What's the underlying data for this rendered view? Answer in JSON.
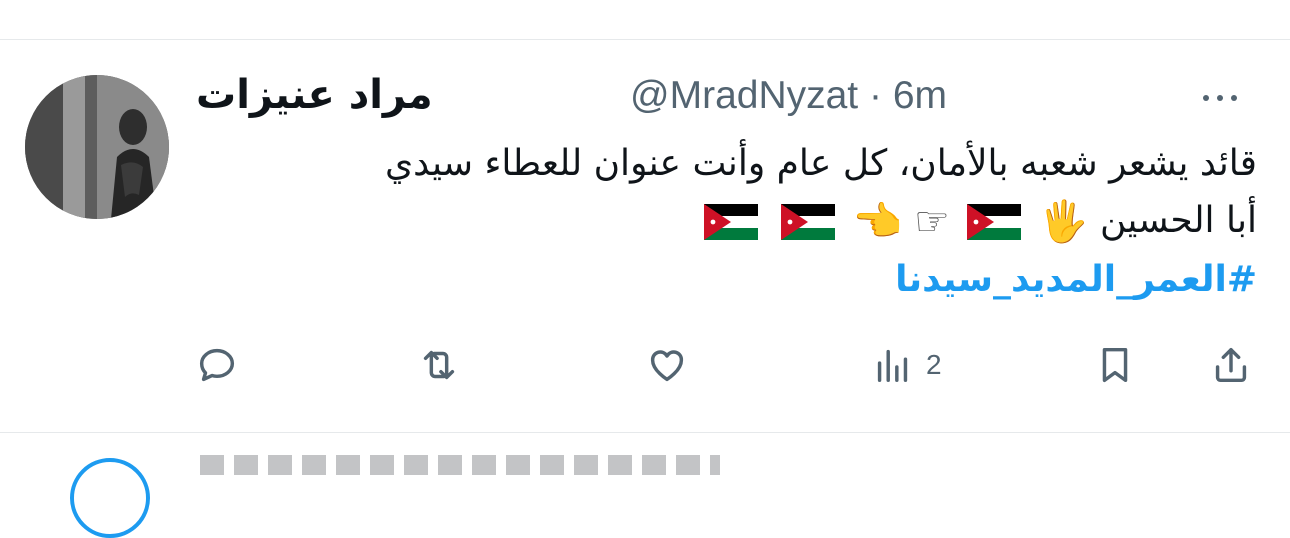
{
  "author": {
    "display_name": "مراد عنيزات",
    "handle": "@MradNyzat",
    "separator": "·",
    "time_ago": "6m"
  },
  "tweet": {
    "line1": "قائد يشعر شعبه بالأمان، كل عام وأنت عنوان للعطاء سيدي",
    "line2_text": "أبا الحسين",
    "emoji_hand": "🖐",
    "emoji_pointer_outline": "☞",
    "emoji_pointer": "👈",
    "hashtag": "#العمر_المديد_سيدنا"
  },
  "actions": {
    "views_count": "2"
  },
  "icons": {
    "more": "more-horizontal-icon",
    "reply": "reply-icon",
    "retweet": "retweet-icon",
    "like": "heart-icon",
    "views": "views-chart-icon",
    "bookmark": "bookmark-icon",
    "share": "share-icon"
  },
  "colors": {
    "text": "#0f1419",
    "muted": "#536471",
    "link": "#1d9bf0",
    "divider": "#e6e9eb",
    "flag_black": "#000000",
    "flag_green": "#007a3d",
    "flag_red": "#ce1126"
  }
}
